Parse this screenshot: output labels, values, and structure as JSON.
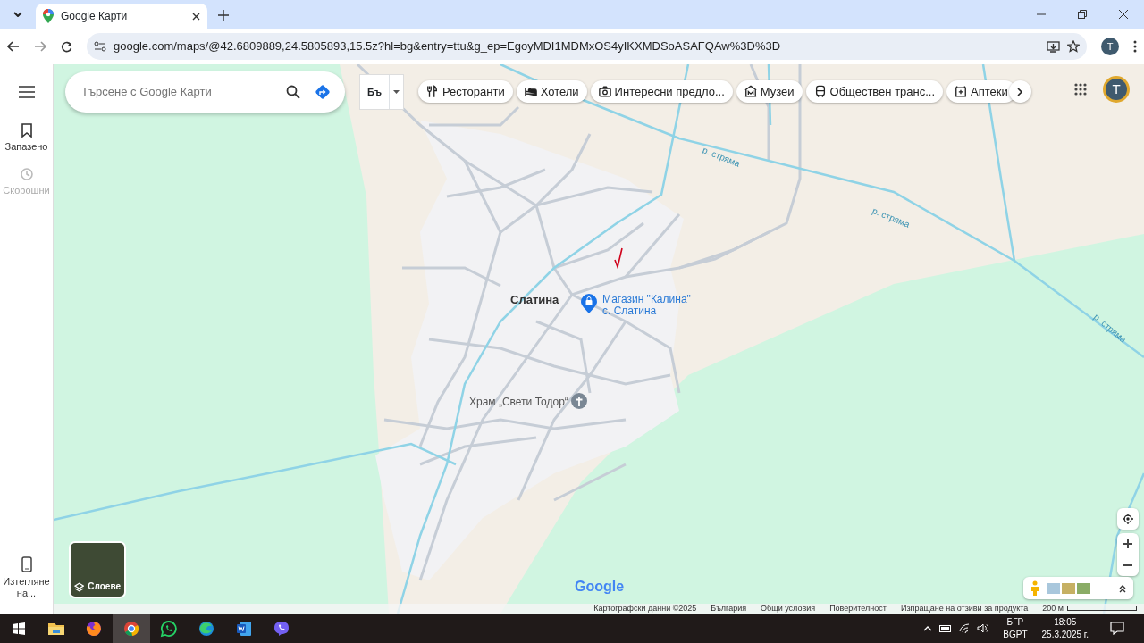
{
  "browser": {
    "tab": {
      "title": "Google Карти"
    },
    "url": "google.com/maps/@42.6809889,24.5805893,15.5z?hl=bg&entry=ttu&g_ep=EgoyMDI1MDMxOS4yIKXMDSoASAFQAw%3D%3D",
    "profile_initial": "T"
  },
  "sidebar": {
    "items": [
      {
        "label": "Запазено",
        "disabled": false
      },
      {
        "label": "Скорошни",
        "disabled": true
      }
    ],
    "download": {
      "label": "Изтегляне на..."
    }
  },
  "search": {
    "placeholder": "Търсене с Google Карти"
  },
  "input_tool": {
    "label": "Бъ"
  },
  "chips": [
    {
      "label": "Ресторанти",
      "kind": "restaurant"
    },
    {
      "label": "Хотели",
      "kind": "hotel"
    },
    {
      "label": "Интересни предло...",
      "kind": "camera"
    },
    {
      "label": "Музеи",
      "kind": "museum"
    },
    {
      "label": "Обществен транс...",
      "kind": "transit"
    },
    {
      "label": "Аптеки",
      "kind": "pharmacy"
    }
  ],
  "account": {
    "initial": "T"
  },
  "map": {
    "places": [
      {
        "name": "Слатина",
        "kind": "town"
      },
      {
        "name": "Магазин \"Калина\" с. Слатина",
        "kind": "shop"
      },
      {
        "name": "Храм „Свети Тодор“",
        "kind": "church"
      }
    ],
    "rivers": [
      {
        "label": "р. стряма"
      },
      {
        "label": "р. стряма"
      },
      {
        "label": "р. стряма"
      }
    ],
    "layers_label": "Слоеве",
    "logo": "Google",
    "footer": [
      "Картографски данни ©2025",
      "България",
      "Общи условия",
      "Поверителност",
      "Изпращане на отзиви за продукта"
    ],
    "scale": "200 м"
  },
  "taskbar": {
    "apps": [
      {
        "kind": "files",
        "active": false
      },
      {
        "kind": "firefox",
        "active": false
      },
      {
        "kind": "chrome",
        "active": true
      },
      {
        "kind": "whatsapp",
        "active": false
      },
      {
        "kind": "edge",
        "active": false
      },
      {
        "kind": "word",
        "active": false
      },
      {
        "kind": "viber",
        "active": false
      }
    ],
    "language": "БГР",
    "layout": "BGPT",
    "time": "18:05",
    "date": "25.3.2025 г."
  }
}
